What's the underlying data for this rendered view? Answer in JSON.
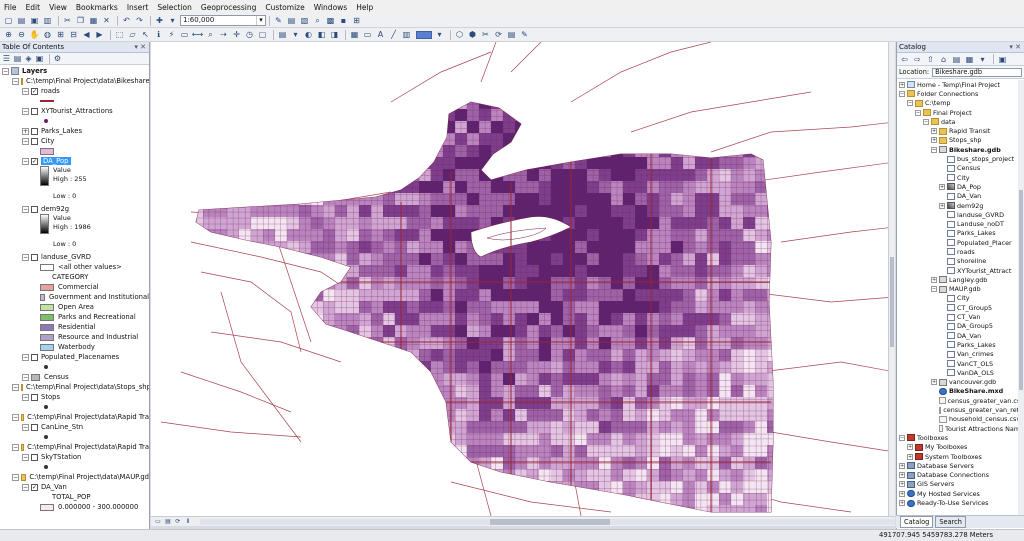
{
  "menu": [
    "File",
    "Edit",
    "View",
    "Bookmarks",
    "Insert",
    "Selection",
    "Geoprocessing",
    "Customize",
    "Windows",
    "Help"
  ],
  "toolbar": {
    "scale": "1:60,000"
  },
  "toc": {
    "title": "Table Of Contents",
    "items": {
      "layers": "Layers",
      "bikeshare_path": "C:\\temp\\Final Project\\data\\Bikeshare",
      "roads": "roads",
      "xytourist": "XYTourist_Attractions",
      "parks_lakes": "Parks_Lakes",
      "city": "City",
      "da_pop": "DA_Pop",
      "value1": "Value",
      "high1": "High : 255",
      "low1": "Low : 0",
      "dem92g": "dem92g",
      "value2": "Value",
      "high2": "High : 1986",
      "low2": "Low : 0",
      "landuse": "landuse_GVRD",
      "all_other": "<all other values>",
      "category": "CATEGORY",
      "lu1": "Commercial",
      "lu2": "Government and Institutional",
      "lu3": "Open Area",
      "lu4": "Parks and Recreational",
      "lu5": "Residential",
      "lu6": "Resource and Industrial",
      "lu7": "Waterbody",
      "populated": "Populated_Placenames",
      "census": "Census",
      "stops_path": "C:\\temp\\Final Project\\data\\Stops_shp",
      "stops": "Stops",
      "rapid_path1": "C:\\temp\\Final Project\\data\\Rapid Tra",
      "canline": "CanLine_Stn",
      "rapid_path2": "C:\\temp\\Final Project\\data\\Rapid Tra",
      "skyt": "SkyTStation",
      "maup_path": "C:\\temp\\Final Project\\data\\MAUP.gd",
      "da_van": "DA_Van",
      "total_pop": "TOTAL_POP",
      "range1": "0.000000 - 300.000000"
    },
    "colors": {
      "commercial": "#e8a0a0",
      "government": "#c9b1d9",
      "open_area": "#bfe3a0",
      "parks": "#7fbf6a",
      "residential": "#8e79b8",
      "industrial": "#b0a1c9",
      "waterbody": "#a6d1f0",
      "city": "#e9b7d9",
      "census": "#b8b8b8",
      "range1": "#f7e9f3"
    }
  },
  "catalog": {
    "title": "Catalog",
    "location_label": "Location:",
    "location_value": "Bikeshare.gdb",
    "items": {
      "home": "Home - Temp\\Final Project",
      "folder_conn": "Folder Connections",
      "ctemp": "C:\\temp",
      "final_project": "Final Project",
      "data": "data",
      "rapid_transit": "Rapid Transit",
      "stops_shp": "Stops_shp",
      "bikeshare_gdb": "Bikeshare.gdb",
      "bus_stops": "bus_stops_project",
      "census": "Census",
      "city": "City",
      "da_pop": "DA_Pop",
      "da_van": "DA_Van",
      "dem92g": "dem92g",
      "landuse_gvrd": "landuse_GVRD",
      "landuse_nodt": "Landuse_noDT",
      "parks_lakes": "Parks_Lakes",
      "populated": "Populated_Placer",
      "roads": "roads",
      "shoreline": "shoreline",
      "xytourist": "XYTourist_Attract",
      "langley": "Langley.gdb",
      "maup": "MAUP.gdb",
      "m_city": "City",
      "ct_group5": "CT_Group5",
      "ct_van": "CT_Van",
      "da_group5": "DA_Group5",
      "m_da_van": "DA_Van",
      "m_parks": "Parks_Lakes",
      "van_crimes": "Van_crimes",
      "vanct_ols": "VanCT_OLS",
      "vanda_ols": "VanDA_OLS",
      "vancouver": "vancouver.gdb",
      "bikeshare_mxd": "BikeShare.mxd",
      "census_csv": "census_greater_van.csv",
      "census_ref": "census_greater_van_ref.c",
      "household": "household_census.csv",
      "tourist_names": "Tourist Attractions Name",
      "toolboxes": "Toolboxes",
      "my_toolboxes": "My Toolboxes",
      "system_toolboxes": "System Toolboxes",
      "db_servers": "Database Servers",
      "db_conn": "Database Connections",
      "gis_servers": "GIS Servers",
      "hosted": "My Hosted Services",
      "ready": "Ready-To-Use Services"
    },
    "tabs": {
      "catalog": "Catalog",
      "search": "Search"
    }
  },
  "status": {
    "coords": "491707.945  5459783.278 Meters"
  },
  "map": {
    "purple_shades": [
      "#f3e6f3",
      "#e2c6e4",
      "#cfa6d3",
      "#b985c0",
      "#9d63a8",
      "#7d3f8d",
      "#5e2370"
    ],
    "road_color": "#9a2430",
    "line_color": "#7a1f4a"
  }
}
